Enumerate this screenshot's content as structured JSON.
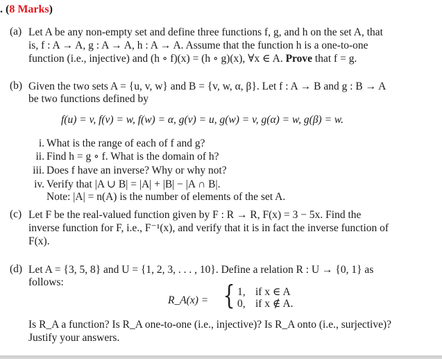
{
  "question": {
    "number_fragment": ".",
    "marks_open": "(",
    "marks_label": "8 Marks",
    "marks_close": ")"
  },
  "part_a": {
    "label": "(a)",
    "lines": [
      "Let A be any non-empty set and define three functions f, g, and h on the set A, that",
      "is, f : A → A, g : A → A, h : A → A. Assume that the function h is a one-to-one",
      "function (i.e., injective) and (h ∘ f)(x) = (h ∘ g)(x), ∀x ∈ A."
    ],
    "prove_word": "Prove",
    "prove_tail": "that f = g."
  },
  "part_b": {
    "label": "(b)",
    "lines": [
      "Given the two sets A = {u, v, w} and B = {v, w, α, β}. Let f : A → B and g : B → A",
      "be two functions defined by"
    ],
    "formula": "f(u) = v, f(v) = w, f(w) = α,   g(v) = u, g(w) = v, g(α) = w, g(β) = w.",
    "subparts": [
      {
        "label": "i.",
        "text": "What is the range of each of f and g?"
      },
      {
        "label": "ii.",
        "text": "Find h = g ∘ f. What is the domain of h?"
      },
      {
        "label": "iii.",
        "text": "Does f have an inverse? Why or why not?"
      },
      {
        "label": "iv.",
        "text": "Verify that |A ∪ B| = |A| + |B| − |A ∩ B|."
      }
    ],
    "note": "Note: |A| = n(A) is the number of elements of the set A."
  },
  "part_c": {
    "label": "(c)",
    "lines": [
      "Let F be the real-valued function given by F : R → R,   F(x) = 3 − 5x. Find the",
      "inverse function for F, i.e., F⁻¹(x), and verify that it is in fact the inverse function of",
      "F(x)."
    ]
  },
  "part_d": {
    "label": "(d)",
    "lines": [
      "Let A = {3, 5, 8} and U = {1, 2, 3, . . . , 10}. Define a relation R : U → {0, 1} as",
      "follows:"
    ],
    "piecewise_lhs": "R_A(x) =",
    "cases": [
      {
        "value": "1,",
        "condition": "if  x ∈ A"
      },
      {
        "value": "0,",
        "condition": "if  x ∉ A."
      }
    ],
    "question_lines": [
      "Is R_A a function?  Is R_A one-to-one (i.e., injective)?  Is R_A onto (i.e., surjective)?",
      "Justify your answers."
    ]
  }
}
